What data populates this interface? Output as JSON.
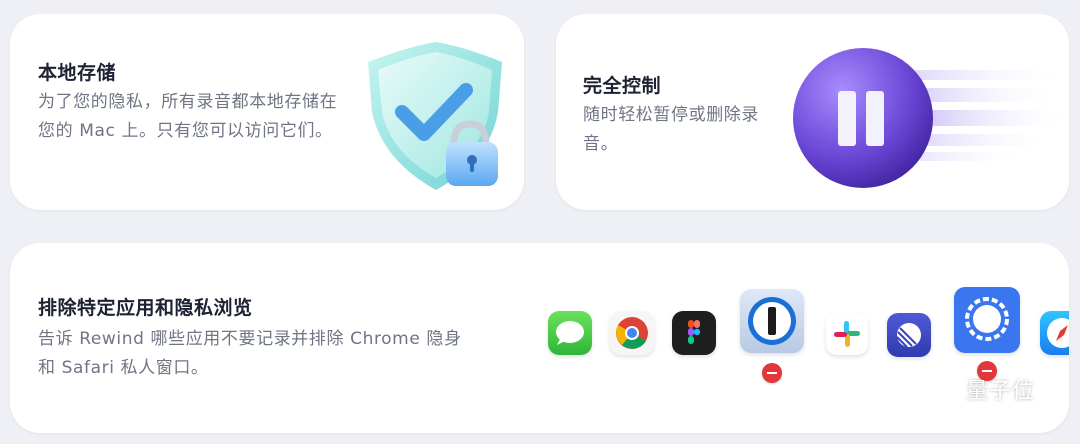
{
  "cards": {
    "local_storage": {
      "title": "本地存储",
      "desc": "为了您的隐私，所有录音都本地存储在您的 Mac 上。只有您可以访问它们。",
      "icon": "shield-lock-icon"
    },
    "full_control": {
      "title": "完全控制",
      "desc": "随时轻松暂停或删除录音。",
      "icon": "pause-icon"
    },
    "exclude_apps": {
      "title": "排除特定应用和隐私浏览",
      "desc": "告诉 Rewind 哪些应用不要记录并排除 Chrome 隐身和 Safari 私人窗口。"
    }
  },
  "dock_apps": [
    {
      "name": "messages-icon",
      "excluded": false
    },
    {
      "name": "chrome-icon",
      "excluded": false
    },
    {
      "name": "figma-icon",
      "excluded": false
    },
    {
      "name": "1password-icon",
      "excluded": true
    },
    {
      "name": "slack-icon",
      "excluded": false
    },
    {
      "name": "linear-icon",
      "excluded": false
    },
    {
      "name": "signal-icon",
      "excluded": true
    },
    {
      "name": "safari-icon",
      "excluded": false
    }
  ],
  "watermark": {
    "text": "量子位"
  },
  "colors": {
    "background": "#eef0f5",
    "title": "#1d2233",
    "desc": "#6f7584",
    "accent_purple": "#6b47d6",
    "shield_teal": "#8fe0dc",
    "remove_red": "#e2383b"
  }
}
